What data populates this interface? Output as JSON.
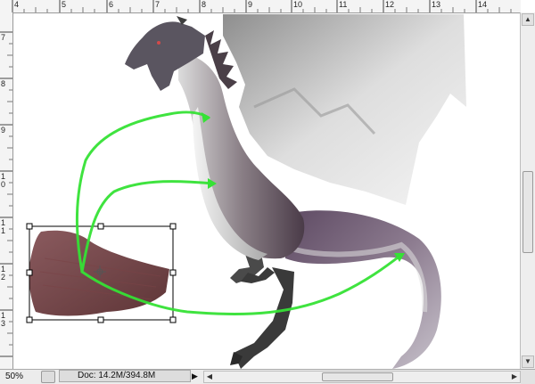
{
  "ruler": {
    "top_labels": [
      "4",
      "5",
      "6",
      "7",
      "8",
      "9",
      "10",
      "11",
      "12",
      "13",
      "14"
    ],
    "left_labels": [
      "7",
      "8",
      "9",
      "10",
      "11",
      "12",
      "13"
    ]
  },
  "status": {
    "zoom": "50%",
    "doc": "Doc: 14.2M/394.8M",
    "menu_arrow": "▶"
  },
  "scroll": {
    "up": "▲",
    "down": "▼",
    "left": "◀",
    "right": "▶"
  }
}
